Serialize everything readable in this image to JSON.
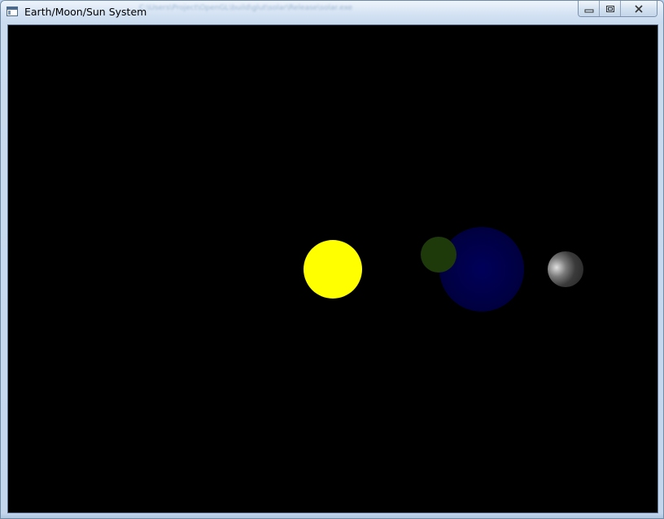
{
  "window": {
    "title": "Earth/Moon/Sun System",
    "icon": "window-app-icon"
  },
  "caption_buttons": {
    "minimize": "minimize-icon",
    "maximize": "maximize-icon",
    "close": "close-icon"
  },
  "scene": {
    "background_color": "#000000",
    "bodies": [
      {
        "name": "sun",
        "color": "#ffff00"
      },
      {
        "name": "earth",
        "color": "#000050"
      },
      {
        "name": "green-body",
        "color": "#1e3a0a"
      },
      {
        "name": "moon",
        "color": "#3a3a3a"
      }
    ]
  }
}
